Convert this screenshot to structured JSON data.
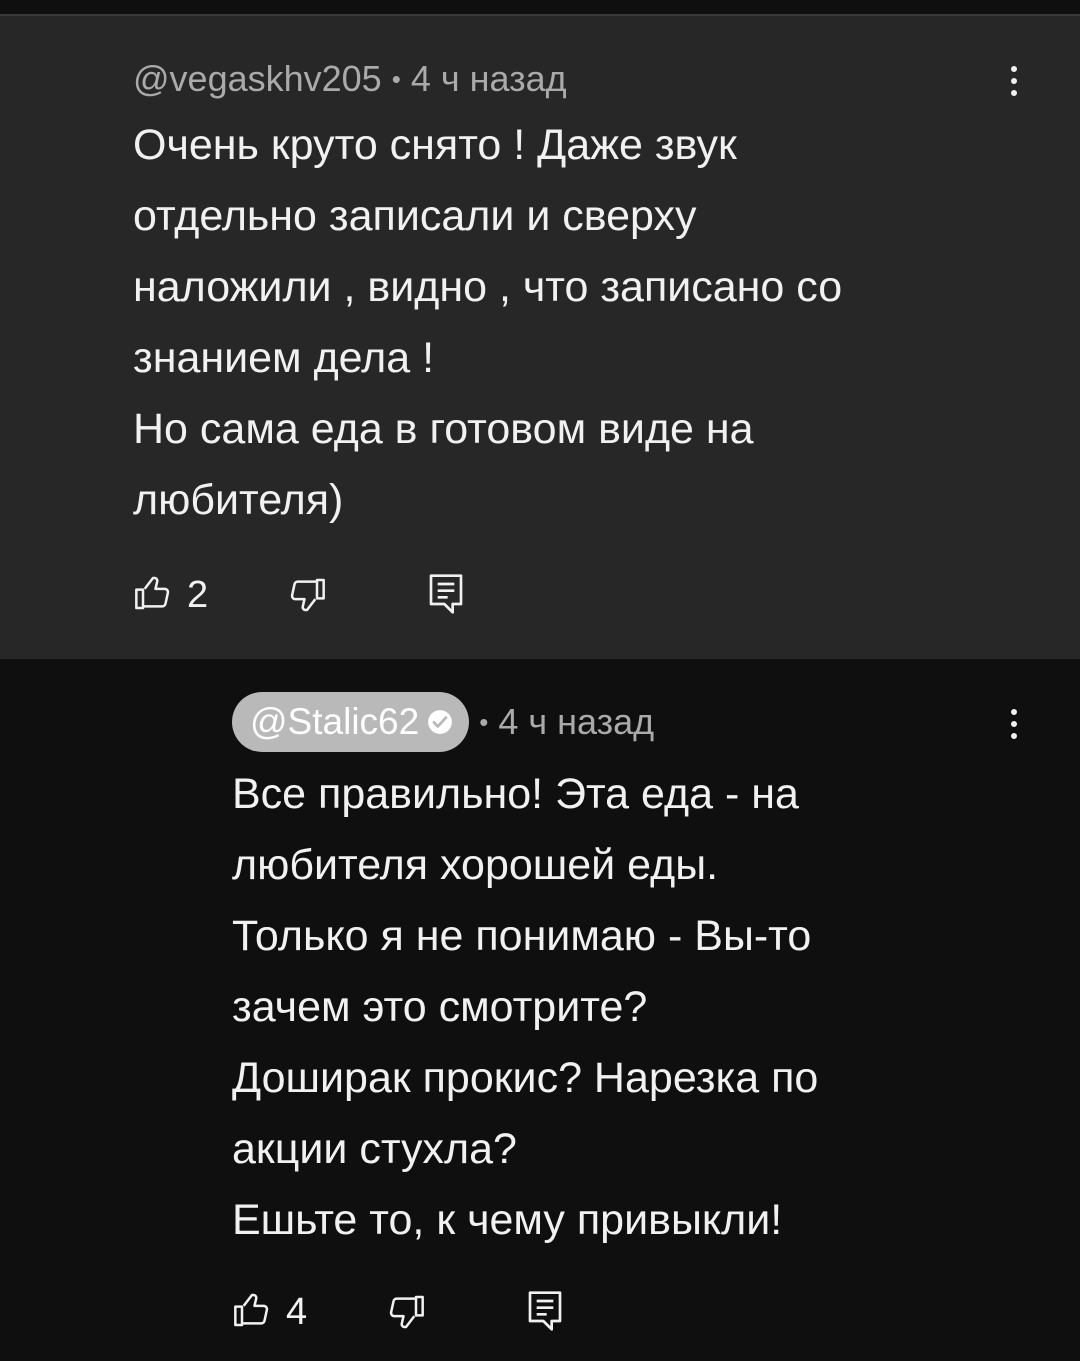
{
  "comments": [
    {
      "author": "@vegaskhv205",
      "separator": "•",
      "time": "4 ч назад",
      "lines": [
        "Очень круто снято ! Даже звук",
        "отдельно записали и сверху",
        "наложили , видно , что записано со",
        "знанием дела !",
        "Но сама еда в готовом виде на",
        "любителя)"
      ],
      "likes": "2",
      "icons": [
        "like-icon",
        "dislike-icon",
        "reply-icon",
        "more-icon"
      ]
    },
    {
      "author": "@Stalic62",
      "verified": true,
      "separator": "•",
      "time": "4 ч назад",
      "lines": [
        "Все правильно! Эта еда - на",
        "любителя хорошей еды.",
        "Только я не понимаю - Вы-то",
        "зачем это смотрите?",
        "Доширак прокис? Нарезка по",
        "акции стухла?",
        "Ешьте то, к чему привыкли!"
      ],
      "likes": "4",
      "icons": [
        "like-icon",
        "dislike-icon",
        "reply-icon",
        "more-icon"
      ]
    }
  ],
  "colors": {
    "main_bg": "#272727",
    "reply_bg": "#0f0f0f",
    "meta": "#aaaaaa",
    "text": "#f1f1f1",
    "chip_bg": "#b9b9b9"
  }
}
